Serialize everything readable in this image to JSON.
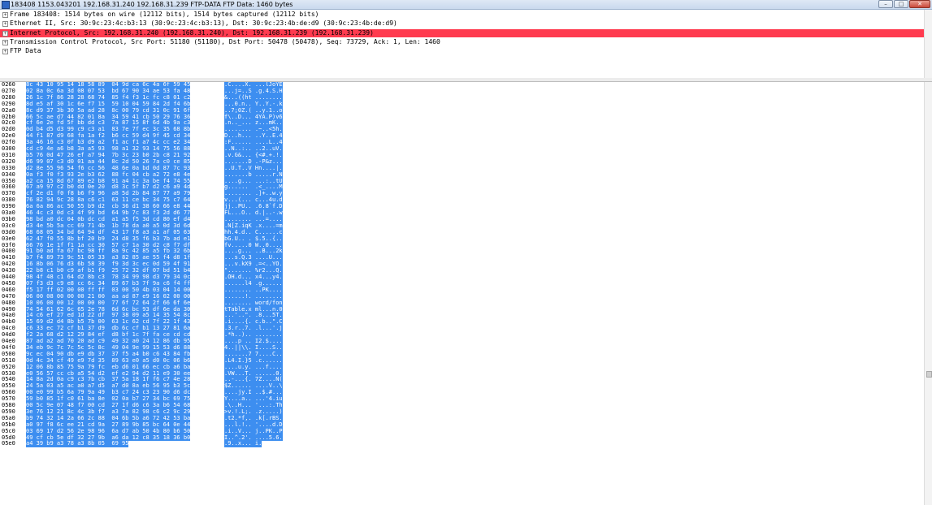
{
  "window": {
    "title": "183408 1153.043201 192.168.31.240 192.168.31.239 FTP-DATA FTP Data: 1460 bytes",
    "minimize": "–",
    "maximize": "□",
    "close": "✕"
  },
  "details": [
    {
      "label": "Frame 183408: 1514 bytes on wire (12112 bits), 1514 bytes captured (12112 bits)",
      "toggle": "+"
    },
    {
      "label": "Ethernet II, Src: 30:9c:23:4c:b3:13 (30:9c:23:4c:b3:13), Dst: 30:9c:23:4b:de:d9 (30:9c:23:4b:de:d9)",
      "toggle": "+"
    },
    {
      "label": "Internet Protocol, Src: 192.168.31.240 (192.168.31.240), Dst: 192.168.31.239 (192.168.31.239)",
      "toggle": "+",
      "selected": true
    },
    {
      "label": "Transmission Control Protocol, Src Port: 51180 (51180), Dst Port: 50478 (50478), Seq: 73729, Ack: 1, Len: 1460",
      "toggle": "+"
    },
    {
      "label": "FTP Data",
      "toggle": "+"
    }
  ],
  "hex_rows": [
    {
      "offset": "0260",
      "hex": "8c 43 10 95 14 18 58 89  04 9d ca 6c 4a 6f 59 45",
      "ascii": ".C....X. ...lJoYE"
    },
    {
      "offset": "0270",
      "hex": "02 8a 0c 6a 3d 08 07 53  bd 67 90 34 ae 53 fa 48",
      "ascii": "...j=..S .g.4.S.H"
    },
    {
      "offset": "0280",
      "hex": "26 1c 7f 86 28 28 68 74  85 f4 f3 1c fc c8 01 c2",
      "ascii": "&...((ht ........"
    },
    {
      "offset": "0290",
      "hex": "8d e5 af 30 1c 6e f7 15  59 10 04 59 84 2d f4 6b",
      "ascii": "...0.n.. Y..Y.-.k"
    },
    {
      "offset": "02a0",
      "hex": "8c d9 37 3b 30 5a ad 28  8c 00 79 cd 31 0c 91 6f",
      "ascii": "..7;0Z.( ..y.1..o"
    },
    {
      "offset": "02b0",
      "hex": "66 5c ae d7 44 82 01 8a  34 59 41 cb 50 29 76 36",
      "ascii": "f\\..D... 4YA.P)v6"
    },
    {
      "offset": "02c0",
      "hex": "cf 6e 2e fd 5f bb dd c3  7a 87 15 8f 6d 4b 9a c3",
      "ascii": ".n.._... z...mK.."
    },
    {
      "offset": "02d0",
      "hex": "0d b4 d5 d3 99 c9 c3 a1  83 7e 7f ec 3c 35 68 8b",
      "ascii": "........ .~..<5h."
    },
    {
      "offset": "02e0",
      "hex": "44 f1 87 d9 68 fa 1a f2  b6 cc 59 d4 9f 45 cd 34",
      "ascii": "D...h... ..Y..E.4"
    },
    {
      "offset": "02f0",
      "hex": "3a 46 16 c3 0f b3 d9 a2  f1 ac f1 a7 4c cc e2 34",
      "ascii": ":F...... ....L..4"
    },
    {
      "offset": "0300",
      "hex": "cd c9 4e a6 b8 3a a5 93  98 a1 32 93 14 75 56 88",
      "ascii": "..N..:.. ..2..uV."
    },
    {
      "offset": "0310",
      "hex": "b5 76 0d 47 26 ef a7 94  7b 3c 23 b0 2b c8 21 92",
      "ascii": ".v.G&... {<#.+.!."
    },
    {
      "offset": "0320",
      "hex": "d6 99 07 c3 d0 01 aa 44  8c 2d 50 26 7a c0 ce 85",
      "ascii": ".......D .-P&z..."
    },
    {
      "offset": "0330",
      "hex": "d2 8e 55 96 54 f6 cc 56  48 6e 0a bd 0d 87 7c 93",
      "ascii": "..U.T..V Hn....|."
    },
    {
      "offset": "0340",
      "hex": "0a f3 f0 f3 93 2e b3 62  88 fc 04 cb a2 72 e8 4e",
      "ascii": ".......b .....r.N"
    },
    {
      "offset": "0350",
      "hex": "a2 ca 15 8d 67 89 e2 b8  91 a4 1c 3a be f4 74 55",
      "ascii": "....g... ...:..tU"
    },
    {
      "offset": "0360",
      "hex": "67 a9 97 c2 b0 dd 0e 20  d8 3c 5f b7 d2 c6 a9 4d",
      "ascii": "g......  .<_....M"
    },
    {
      "offset": "0370",
      "hex": "cf 2e d1 f0 f8 b6 f9 96  a8 5d 2b 84 87 77 a9 79",
      "ascii": "........ .]+..w.y"
    },
    {
      "offset": "0380",
      "hex": "76 82 94 9c 28 8a c6 c1  63 11 ce bc 34 75 c7 64",
      "ascii": "v...(... c...4u.d"
    },
    {
      "offset": "0390",
      "hex": "6a 6a 86 ac 50 55 b9 d2  cb 36 d1 38 60 66 e8 44",
      "ascii": "jj..PU.. .6.8`f.D"
    },
    {
      "offset": "03a0",
      "hex": "46 4c c3 0d c3 4f 99 bd  64 9b 7c 83 f3 2d d6 77",
      "ascii": "FL...O.. d.|..-.w"
    },
    {
      "offset": "03b0",
      "hex": "98 bd a0 dc 04 0b dc cd  a1 a5 f5 3d cd 80 ef d4",
      "ascii": "........ ...=...."
    },
    {
      "offset": "03c0",
      "hex": "d3 4e 5b 5a cc 69 71 4b  1b 78 da a0 a5 0d 3d 6d",
      "ascii": ".N[Z.iqK .x....=m"
    },
    {
      "offset": "03d0",
      "hex": "68 68 05 34 bd 64 94 df  43 17 f8 a3 a1 af 05 63",
      "ascii": "hh.4.d.. C......c"
    },
    {
      "offset": "03e0",
      "hex": "62 47 f0 55 8b bf 20 b9  24 d8 35 f6 b3 7b ad e1",
      "ascii": "bG.U.. . $.5..{.."
    },
    {
      "offset": "03f0",
      "hex": "66 76 1e 1f f1 1a cc 30  57 c7 1a 30 d2 c8 f7 df",
      "ascii": "fv.....0 W..0...."
    },
    {
      "offset": "0400",
      "hex": "91 b0 ad fa 67 bc 98 ff  8a 9c 42 85 a5 fb 32 6b",
      "ascii": "....g... ..B...2k"
    },
    {
      "offset": "0410",
      "hex": "b7 f4 89 73 9c 51 05 33  a3 82 85 ae 55 f4 d8 1f",
      "ascii": "...s.Q.3 ....U..."
    },
    {
      "offset": "0420",
      "hex": "16 8b 06 76 d3 6b 58 39  f9 3d 3c ec 0d 59 4f 91",
      "ascii": "...v.kX9 .=<..YO."
    },
    {
      "offset": "0430",
      "hex": "22 b8 c1 b0 c9 af b1 f9  25 72 32 df 07 bd 51 b4",
      "ascii": "\"....... %r2...Q."
    },
    {
      "offset": "0440",
      "hex": "98 4f 48 c1 64 d2 8b c3  78 34 99 98 d3 79 34 0c",
      "ascii": ".OH.d... x4...y4."
    },
    {
      "offset": "0450",
      "hex": "07 f3 d3 c9 e8 cc 6c 34  89 67 b3 7f 9a c6 f4 ff",
      "ascii": "......l4 .g......"
    },
    {
      "offset": "0460",
      "hex": "f5 17 ff 02 00 00 ff ff  03 00 50 4b 03 04 14 00",
      "ascii": "........ ..PK...."
    },
    {
      "offset": "0470",
      "hex": "06 00 08 00 00 00 21 00  aa ad 87 e9 16 02 00 00",
      "ascii": "......!. ........"
    },
    {
      "offset": "0480",
      "hex": "10 06 00 00 12 00 00 00  77 6f 72 64 2f 66 6f 6e",
      "ascii": "........ word/fon"
    },
    {
      "offset": "0490",
      "hex": "74 54 61 62 6c 65 2e 78  6d 6c bc 93 df 6e da 30",
      "ascii": "tTable.x ml...n.0"
    },
    {
      "offset": "04a0",
      "hex": "14 c6 ef 27 ed 1d 22 df  97 38 09 a5 14 35 54 8c",
      "ascii": "...'..\". .8...5T."
    },
    {
      "offset": "04b0",
      "hex": "15 69 d2 d4 8b b5 7b 00  63 1c 62 cd 7f 22 1f 43",
      "ascii": ".i....{. c.b..\".C"
    },
    {
      "offset": "04c0",
      "hex": "c6 33 ec 72 cf b1 37 d9  db 6c cf b1 13 27 81 6a",
      "ascii": ".3.r..7. .l...'.j"
    },
    {
      "offset": "04d0",
      "hex": "f2 2a 68 d2 12 29 84 ef  d8 bf 1c 7f fa ce cd cd",
      "ascii": ".*h..).. ........"
    },
    {
      "offset": "04e0",
      "hex": "87 ad a2 ad 70 20 ad c9  49 32 a0 24 12 86 db 95",
      "ascii": "....p .. I2.$...."
    },
    {
      "offset": "04f0",
      "hex": "34 eb 9c 7c 7c 5c 5c 8c  49 04 9e 99 15 53 d6 88",
      "ascii": "4..||\\\\. I....S.."
    },
    {
      "offset": "0500",
      "hex": "9c ec 04 90 db e9 db 37  37 f5 a4 b0 c6 43 84 fb",
      "ascii": ".......7 7....C.."
    },
    {
      "offset": "0510",
      "hex": "0d 4c 34 cf 49 e9 7d 35  89 63 e0 a5 d0 0c 06 b6",
      "ascii": ".L4.I.}5 .c......"
    },
    {
      "offset": "0520",
      "hex": "12 06 8b 85 75 9a 79 fc  eb d6 01 66 ec cb a6 ba",
      "ascii": "....u.y. ...f...."
    },
    {
      "offset": "0530",
      "hex": "e0 56 57 cc cb a5 54 d2  ef e2 94 d2 11 e9 30 ee",
      "ascii": ".VW...T. ......0."
    },
    {
      "offset": "0540",
      "hex": "14 8a 2d 0a c9 c3 7b cb  37 5a 18 1f f6 c7 4e 28",
      "ascii": "..-...{. 7Z....N("
    },
    {
      "offset": "0550",
      "hex": "24 5a 03 a5 ac a0 a7 d5  a7 d0 8a eb 56 95 b3 5c",
      "ascii": "$Z...... ....V..\\"
    },
    {
      "offset": "0560",
      "hex": "00 e0 99 b5 6a 79 9a 49  b3 c7 24 c3 23 90 d6 dc",
      "ascii": "....jy.I ..$.#..."
    },
    {
      "offset": "0570",
      "hex": "59 b0 85 1f c0 61 ba 8e  02 0a b7 27 34 bc 69 75",
      "ascii": "Y....a.. ...'4.iu"
    },
    {
      "offset": "0580",
      "hex": "00 5c 9e 07 48 f7 00 cd  27 1f d6 c6 3a b6 54 68",
      "ascii": ".\\..H... '...:.Th"
    },
    {
      "offset": "0590",
      "hex": "3e 76 12 21 8c 4c 3b f7  a3 7a 82 98 c6 c2 9c 29",
      "ascii": ">v.!.L;. .z.....)"
    },
    {
      "offset": "05a0",
      "hex": "b9 74 32 14 2a 66 2c 88  04 6b 5b a6 72 42 53 ba",
      "ascii": ".t2.*f,. .k[.rBS."
    },
    {
      "offset": "05b0",
      "hex": "a0 97 f8 6c ee 21 cd 9a  27 89 9b 85 bc 64 0e 44",
      "ascii": "...l.!.. '....d.D"
    },
    {
      "offset": "05c0",
      "hex": "03 69 17 d2 56 2e 98 96  6a d7 ab 50 4b 80 b6 50",
      "ascii": ".i..V... j..PK..P"
    },
    {
      "offset": "05d0",
      "hex": "49 cf cb 5e df 32 27 9b  a6 da 12 c8 35 18 36 b0",
      "ascii": "I..^.2'. ....5.6."
    },
    {
      "offset": "05e0",
      "hex": "a4 39 b9 a3 78 a3 8b 05  69 95",
      "ascii": ".9..x... i."
    }
  ]
}
